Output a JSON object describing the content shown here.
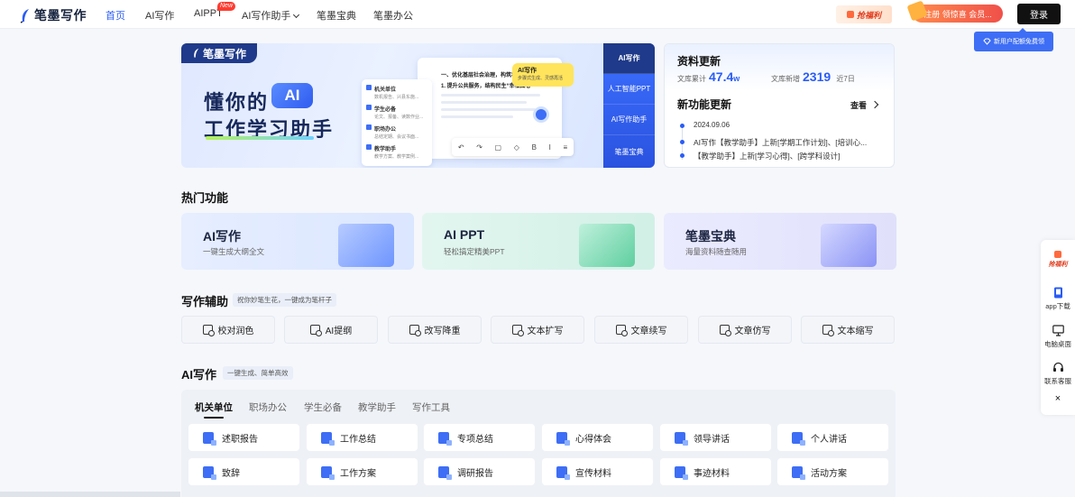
{
  "nav": {
    "logo_text": "笔墨写作",
    "items": [
      {
        "label": "首页",
        "active": true
      },
      {
        "label": "AI写作"
      },
      {
        "label": "AIPPT",
        "badge": "New"
      },
      {
        "label": "AI写作助手",
        "has_dropdown": true
      },
      {
        "label": "笔墨宝典"
      },
      {
        "label": "笔墨办公"
      }
    ],
    "lucky_label": "抢福利",
    "register_label": "注册 领惊喜 会员...",
    "login_label": "登录",
    "newuser_tip": "新用户配额免费领"
  },
  "banner": {
    "tag": "笔墨写作",
    "title_line1_prefix": "懂你的",
    "title_ai": "AI",
    "title_line2": "工作学习助手",
    "doc_items": [
      {
        "title": "机关单位",
        "sub": "数机报告、兴县东施..."
      },
      {
        "title": "学生必备",
        "sub": "论文、报备、读数作业..."
      },
      {
        "title": "职场办公",
        "sub": "总结定期、会议书面..."
      },
      {
        "title": "教学助手",
        "sub": "教学方案、教学案例..."
      }
    ],
    "doc_headline1": "一、优化基层社会治理，构筑和谐",
    "doc_headline2": "1. 提升公共服务，结构民生“幸福图卷”",
    "doc_bubble_title": "AI写作",
    "doc_bubble_sub": "步骤式生成、灵感再活",
    "side_tabs": [
      "AI写作",
      "人工智能PPT",
      "AI写作助手",
      "笔墨宝典"
    ]
  },
  "update": {
    "title": "资料更新",
    "stat1_label": "文库累计",
    "stat1_value": "47.4",
    "stat1_unit": "w",
    "stat2_label": "文库新增",
    "stat2_value": "2319",
    "stat2_suffix": "近7日",
    "feature_title": "新功能更新",
    "view_label": "查看",
    "date": "2024.09.06",
    "items": [
      "AI写作【教学助手】上新[学期工作计划]、[培训心...",
      "【教学助手】上新[学习心得]、[跨学科设计]"
    ]
  },
  "hot": {
    "title": "热门功能",
    "cards": [
      {
        "name": "AI写作",
        "desc": "一键生成大纲全文"
      },
      {
        "name": "AI PPT",
        "desc": "轻松搞定精美PPT"
      },
      {
        "name": "笔墨宝典",
        "desc": "海量资料随查随用"
      }
    ]
  },
  "aux": {
    "title": "写作辅助",
    "subtitle": "祝你妙笔生花，一键成为笔杆子",
    "buttons": [
      "校对润色",
      "AI提纲",
      "改写降重",
      "文本扩写",
      "文章续写",
      "文章仿写",
      "文本缩写"
    ]
  },
  "ai_writing": {
    "title": "AI写作",
    "subtitle": "一键生成、简单高效",
    "tabs": [
      "机关单位",
      "职场办公",
      "学生必备",
      "教学助手",
      "写作工具"
    ],
    "templates": [
      [
        "述职报告",
        "工作总结",
        "专项总结",
        "心得体会",
        "领导讲话",
        "个人讲话"
      ],
      [
        "致辞",
        "工作方案",
        "调研报告",
        "宣传材料",
        "事迹材料",
        "活动方案"
      ]
    ]
  },
  "float": {
    "lucky_label": "抢福利",
    "items": [
      "app下载",
      "电脑桌面",
      "联系客服"
    ],
    "close": "×"
  },
  "colors": {
    "accent": "#2a5cf6",
    "banner_side": "#3d70ff",
    "register": "#f0504a"
  }
}
